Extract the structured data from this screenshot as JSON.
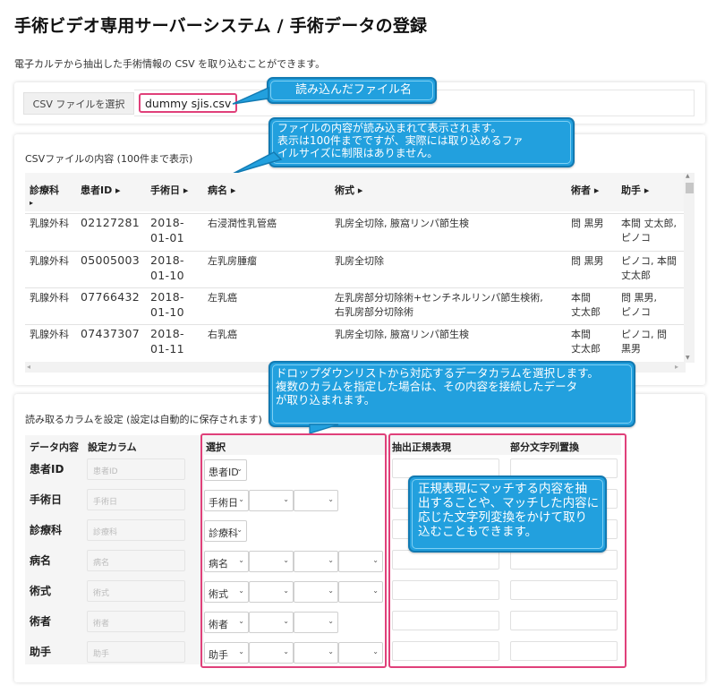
{
  "header": {
    "title": "手術ビデオ専用サーバーシステム / 手術データの登録",
    "subtitle": "電子カルテから抽出した手術情報の CSV を取り込むことができます。"
  },
  "file": {
    "button_label": "CSV ファイルを選択",
    "filename": "dummy sjis.csv"
  },
  "callouts": {
    "filename": "読み込んだファイル名",
    "content_line1": "ファイルの内容が読み込まれて表示されます。",
    "content_line2": "表示は100件までですが、実際には取り込めるファ",
    "content_line3": "イルサイズに制限はありません。",
    "dropdown_line1": "ドロップダウンリストから対応するデータカラムを選択します。",
    "dropdown_line2": "複数のカラムを指定した場合は、その内容を接続したデータ",
    "dropdown_line3": "が取り込まれます。",
    "regex_line1": "正規表現にマッチする内容を抽",
    "regex_line2": "出することや、マッチした内容に",
    "regex_line3": "応じた文字列変換をかけて取り",
    "regex_line4": "込むこともできます。"
  },
  "preview": {
    "title": "CSVファイルの内容 (100件まで表示)",
    "columns": [
      "診療科",
      "患者ID ▸",
      "手術日 ▸",
      "病名 ▸",
      "術式 ▸",
      "術者 ▸",
      "助手 ▸"
    ],
    "sort_arrow": "▸",
    "rows": [
      {
        "dept": "乳腺外科",
        "pid": "02127281",
        "date1": "2018-",
        "date2": "01-01",
        "disease": "右浸潤性乳管癌",
        "proc1": "乳房全切除, 腋窩リンパ節生検",
        "proc2": "",
        "surgeon1": "問 黒男",
        "surgeon2": "",
        "assist1": "本間 丈太郎,",
        "assist2": "ピノコ"
      },
      {
        "dept": "乳腺外科",
        "pid": "05005003",
        "date1": "2018-",
        "date2": "01-10",
        "disease": "左乳房腫瘤",
        "proc1": "乳房全切除",
        "proc2": "",
        "surgeon1": "問 黒男",
        "surgeon2": "",
        "assist1": "ピノコ, 本間",
        "assist2": "丈太郎"
      },
      {
        "dept": "乳腺外科",
        "pid": "07766432",
        "date1": "2018-",
        "date2": "01-10",
        "disease": "左乳癌",
        "proc1": "左乳房部分切除術+センチネルリンパ節生検術,",
        "proc2": "右乳房部分切除術",
        "surgeon1": "本間",
        "surgeon2": "丈太郎",
        "assist1": "問 黒男,",
        "assist2": "ピノコ"
      },
      {
        "dept": "乳腺外科",
        "pid": "07437307",
        "date1": "2018-",
        "date2": "01-11",
        "disease": "右乳癌",
        "proc1": "乳房全切除, 腋窩リンパ節生検",
        "proc2": "",
        "surgeon1": "本間",
        "surgeon2": "丈太郎",
        "assist1": "ピノコ, 問",
        "assist2": "黒男"
      }
    ]
  },
  "mapping": {
    "title": "読み取るカラムを設定 (設定は自動的に保存されます)",
    "headers": {
      "data": "データ内容",
      "setting": "設定カラム",
      "select": "選択",
      "regex": "抽出正規表現",
      "replace": "部分文字列置換"
    },
    "rows": [
      {
        "label": "患者ID",
        "placeholder": "患者ID",
        "selects": [
          "患者ID"
        ]
      },
      {
        "label": "手術日",
        "placeholder": "手術日",
        "selects": [
          "手術日",
          "",
          ""
        ]
      },
      {
        "label": "診療科",
        "placeholder": "診療科",
        "selects": [
          "診療科"
        ]
      },
      {
        "label": "病名",
        "placeholder": "病名",
        "selects": [
          "病名",
          "",
          "",
          ""
        ]
      },
      {
        "label": "術式",
        "placeholder": "術式",
        "selects": [
          "術式",
          "",
          "",
          ""
        ]
      },
      {
        "label": "術者",
        "placeholder": "術者",
        "selects": [
          "術者",
          "",
          ""
        ]
      },
      {
        "label": "助手",
        "placeholder": "助手",
        "selects": [
          "助手",
          "",
          "",
          ""
        ]
      }
    ]
  },
  "icons": {
    "chevron": "⌄",
    "scroll_up": "▲",
    "scroll_down": "▼",
    "scroll_left": "◂",
    "scroll_right": "▸"
  },
  "colors": {
    "callout": "#22a0de",
    "highlight": "#e0407a"
  }
}
